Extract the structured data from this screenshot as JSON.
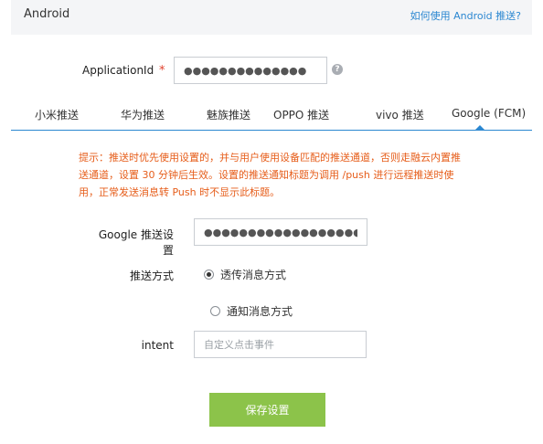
{
  "header": {
    "title": "Android",
    "help_link": "如何使用 Android 推送?"
  },
  "appid": {
    "label": "ApplicationId",
    "required_mark": "*",
    "value": "●●●●●●●●●●●●●●",
    "help_icon": "?"
  },
  "tabs": [
    {
      "label": "小米推送"
    },
    {
      "label": "华为推送"
    },
    {
      "label": "魅族推送"
    },
    {
      "label": "OPPO 推送"
    },
    {
      "label": "vivo 推送"
    },
    {
      "label": "Google (FCM)"
    }
  ],
  "active_tab_index": 5,
  "notice": {
    "text": "提示：推送时优先使用设置的，并与用户使用设备匹配的推送通道，否则走融云内置推送通道，设置 30 分钟后生效。设置的推送通知标题为调用 /push 进行远程推送时使用，正常发送消息转 Push 时不显示此标题。"
  },
  "google_setting": {
    "label": "Google 推送设置",
    "value": "●●●●●●●●●●●●●●●●●●●●●●●●●●"
  },
  "push_mode": {
    "label": "推送方式",
    "options": [
      {
        "label": "透传消息方式",
        "checked": true
      },
      {
        "label": "通知消息方式",
        "checked": false
      }
    ]
  },
  "intent": {
    "label": "intent",
    "placeholder": "自定义点击事件",
    "value": ""
  },
  "save_button": {
    "label": "保存设置"
  },
  "colors": {
    "accent": "#2b87d1",
    "notice": "#e65d1a",
    "required": "#e0402d",
    "save_button": "#8cc34a",
    "header_bg": "#f4f5f7"
  },
  "icons": {
    "help": "help-icon",
    "tab_indicator": "caret-up-icon"
  }
}
